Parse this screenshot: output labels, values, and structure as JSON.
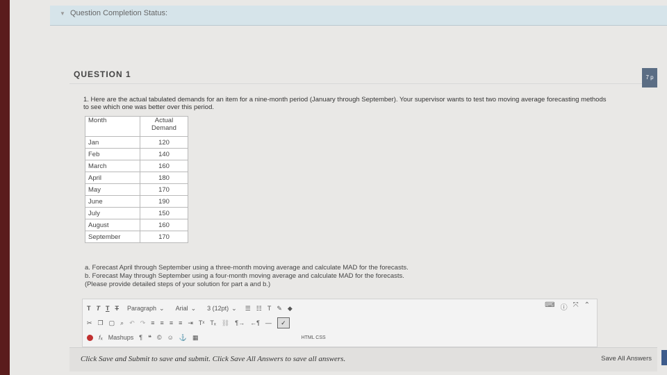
{
  "status": {
    "label": "Question Completion Status:"
  },
  "question": {
    "title": "QUESTION 1",
    "points": "7 p",
    "prompt": "1. Here are the actual tabulated demands for an item for a nine-month period (January through September). Your supervisor wants to test two moving average forecasting methods to see which one was better over this period.",
    "table": {
      "headers": [
        "Month",
        "Actual Demand"
      ],
      "rows": [
        [
          "Jan",
          "120"
        ],
        [
          "Feb",
          "140"
        ],
        [
          "March",
          "160"
        ],
        [
          "April",
          "180"
        ],
        [
          "May",
          "170"
        ],
        [
          "June",
          "190"
        ],
        [
          "July",
          "150"
        ],
        [
          "August",
          "160"
        ],
        [
          "September",
          "170"
        ]
      ]
    },
    "parts": [
      "a. Forecast April through September using a three-month moving average and calculate MAD for the forecasts.",
      "b. Forecast May through September using a four-month moving average and calculate MAD for the forecasts.",
      "(Please provide detailed steps of your solution for part a and b.)"
    ]
  },
  "editor": {
    "format_buttons": [
      "T",
      "T",
      "T",
      "T"
    ],
    "paragraph": "Paragraph",
    "font": "Arial",
    "size": "3 (12pt)",
    "mashups": "Mashups",
    "html_label": "HTML CSS"
  },
  "footer": {
    "note": "Click Save and Submit to save and submit. Click Save All Answers to save all answers.",
    "save_all": "Save All Answers"
  }
}
